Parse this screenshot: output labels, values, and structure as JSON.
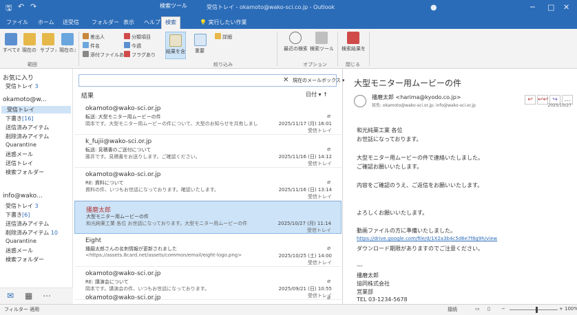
{
  "window": {
    "title": "受信トレイ - okamoto@wako-sci.co.jp - Outlook",
    "contextual_tab": "検索ツール",
    "controls": [
      "─",
      "□",
      "✕"
    ]
  },
  "tabs": [
    "ファイル",
    "ホーム",
    "送受信",
    "フォルダー",
    "表示",
    "ヘルプ",
    "検索"
  ],
  "active_tab_index": 6,
  "tell_me": "実行したい作業",
  "ribbon": {
    "groups": [
      {
        "label": "範囲",
        "buttons": [
          "すべてのメールアイテム",
          "現在のフォルダー",
          "サブフォルダー",
          "現在のメールボックス"
        ]
      },
      {
        "label": "結果",
        "buttons": [
          "結果を含める"
        ]
      },
      {
        "label": "絞り込み",
        "buttons": [
          "差出人",
          "件名",
          "添付ファイルあり",
          "分類項目",
          "今週",
          "フラグあり",
          "重要",
          "詳細"
        ]
      },
      {
        "label": "オプション",
        "buttons": [
          "最近の検索",
          "検索ツール"
        ]
      },
      {
        "label": "閉じる",
        "buttons": [
          "検索結果を閉じる"
        ]
      }
    ]
  },
  "folders": {
    "favorites_label": "お気に入り",
    "favorites": [
      {
        "name": "受信トレイ",
        "count": "3"
      }
    ],
    "accounts": [
      {
        "name": "okamoto@w...",
        "items": [
          {
            "name": "受信トレイ",
            "count": "",
            "selected": true
          },
          {
            "name": "下書き",
            "count": "[16]"
          },
          {
            "name": "送信済みアイテム",
            "count": ""
          },
          {
            "name": "削除済みアイテム",
            "count": ""
          },
          {
            "name": "Quarantine",
            "count": ""
          },
          {
            "name": "迷惑メール",
            "count": ""
          },
          {
            "name": "送信トレイ",
            "count": ""
          },
          {
            "name": "検索フォルダー",
            "count": ""
          }
        ]
      },
      {
        "name": "info@wako...",
        "items": [
          {
            "name": "受信トレイ",
            "count": "3"
          },
          {
            "name": "下書き",
            "count": "[6]"
          },
          {
            "name": "送信済みアイテム",
            "count": ""
          },
          {
            "name": "削除済みアイテム",
            "count": "10"
          },
          {
            "name": "Quarantine",
            "count": ""
          },
          {
            "name": "迷惑メール",
            "count": ""
          },
          {
            "name": "検索フォルダー",
            "count": ""
          }
        ]
      }
    ]
  },
  "message_list": {
    "search_value": "",
    "scope": "現在のメールボックス",
    "group_header": "結果",
    "sort_label": "日付",
    "messages": [
      {
        "from": "okamoto@wako-sci.or.jp",
        "subject": "転送: 大型モニター用ムービーの件",
        "preview": "岡本です。大型モニター用ムービーの件について、大型のお知らせを共有しました。",
        "date": "2025/11/17 (月) 16:01",
        "folder": "受信トレイ",
        "attachment": true
      },
      {
        "from": "k_fujii@wako-sci.or.jp",
        "subject": "転送: 見積書のご送付について",
        "preview": "藤井です。見積書をお送りします。ご確認ください。",
        "date": "2025/11/16 (日) 14:12",
        "folder": "受信トレイ",
        "attachment": true
      },
      {
        "from": "okamoto@wako-sci.or.jp",
        "subject": "RE: 資料について",
        "preview": "資料の件、いつもお世話になっております。確認いたします。",
        "date": "2025/11/16 (日) 13:14",
        "folder": "受信トレイ",
        "attachment": true
      },
      {
        "from": "播磨太郎",
        "subject": "大型モニター用ムービーの件",
        "preview": "和光純薬工業 各位 お世話になっております。大型モニター用ムービーの件",
        "date": "2025/10/27 (月) 11:14",
        "folder": "受信トレイ",
        "attachment": false,
        "selected": true
      },
      {
        "from": "Eight",
        "subject": "播磨太郎さんの名刺情報が更新されました",
        "preview": "<https://assets.8card.net/assets/common/email/eight-logo.png>",
        "date": "2025/10/25 (土) 14:00",
        "folder": "受信トレイ",
        "attachment": true
      },
      {
        "from": "okamoto@wako-sci.or.jp",
        "subject": "RE: 講演会について",
        "preview": "岡本です。講演会の件、いつもお世話になっております。",
        "date": "2025/09/21 (日) 10:55",
        "folder": "受信トレイ",
        "attachment": true
      },
      {
        "from": "okamoto@wako-sci.or.jp",
        "subject": "",
        "preview": "",
        "date": "",
        "folder": "",
        "attachment": true
      }
    ]
  },
  "reading_pane": {
    "subject": "大型モニター用ムービーの件",
    "from": "播磨太郎 <harima@kyodo.co.jp>",
    "to": "宛先: okamoto@wako-sci.or.jp; info@wako-sci.or.jp",
    "date": "2025/10/27",
    "actions": [
      "↩",
      "↩↩",
      "↪",
      "…"
    ],
    "body": [
      "和光純薬工業 各位",
      "お世話になっております。",
      "",
      "大型モニター用ムービーの件で連絡いたしました。",
      "ご確認お願いいたします。",
      "",
      "内容をご確認のうえ、ご返信をお願いいたします。",
      "",
      "よろしくお願いいたします。",
      "",
      "動画ファイルの方に準備いたしました。",
      "https://drive.google.com/file/d/1X2a3b4c5d6e7f8g9h/view",
      "ダウンロード期限がありますのでご注意ください。",
      "",
      "---",
      "播磨太郎",
      "協同株式会社",
      "営業部",
      "TEL 03-1234-5678"
    ]
  },
  "statusbar": {
    "left": "フィルター 適用",
    "middle": "接続",
    "zoom": "100%",
    "zoom_level": 0.55
  },
  "colors": {
    "title_blue": "#2b6cb8",
    "selection": "#cde3f7",
    "link": "#2b6cb8"
  }
}
